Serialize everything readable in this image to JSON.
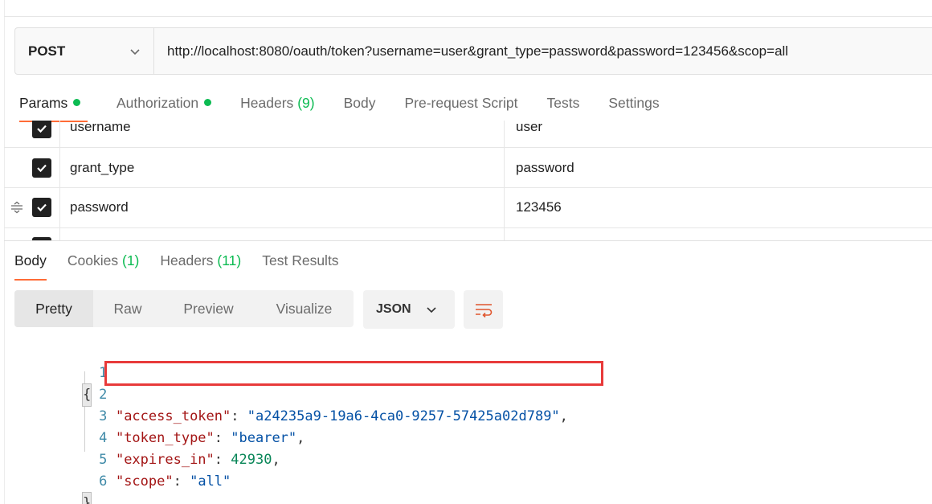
{
  "request": {
    "method": "POST",
    "url": "http://localhost:8080/oauth/token?username=user&grant_type=password&password=123456&scop=all"
  },
  "request_tabs": {
    "params": "Params",
    "authorization": "Authorization",
    "headers": "Headers",
    "headers_count": "(9)",
    "body": "Body",
    "pre_request": "Pre-request Script",
    "tests": "Tests",
    "settings": "Settings"
  },
  "params": [
    {
      "key": "username",
      "value": "user",
      "checked": true
    },
    {
      "key": "grant_type",
      "value": "password",
      "checked": true
    },
    {
      "key": "password",
      "value": "123456",
      "checked": true
    }
  ],
  "response_tabs": {
    "body": "Body",
    "cookies": "Cookies",
    "cookies_count": "(1)",
    "headers": "Headers",
    "headers_count": "(11)",
    "test_results": "Test Results"
  },
  "view_modes": {
    "pretty": "Pretty",
    "raw": "Raw",
    "preview": "Preview",
    "visualize": "Visualize"
  },
  "format": "JSON",
  "response_body": {
    "line_numbers": [
      "1",
      "2",
      "3",
      "4",
      "5",
      "6"
    ],
    "open_brace": "{",
    "close_brace": "}",
    "fields": [
      {
        "key": "\"access_token\"",
        "value": "\"a24235a9-19a6-4ca0-9257-57425a02d789\"",
        "type": "string",
        "comma": ","
      },
      {
        "key": "\"token_type\"",
        "value": "\"bearer\"",
        "type": "string",
        "comma": ","
      },
      {
        "key": "\"expires_in\"",
        "value": "42930",
        "type": "number",
        "comma": ","
      },
      {
        "key": "\"scope\"",
        "value": "\"all\"",
        "type": "string",
        "comma": ""
      }
    ]
  },
  "colors": {
    "accent": "#ff6c37",
    "status_green": "#0cbb52",
    "highlight_box": "#e83a3a"
  },
  "icons": [
    "chevron-down-icon",
    "checkbox-checked-icon",
    "drag-handle-icon",
    "wrap-lines-icon"
  ]
}
